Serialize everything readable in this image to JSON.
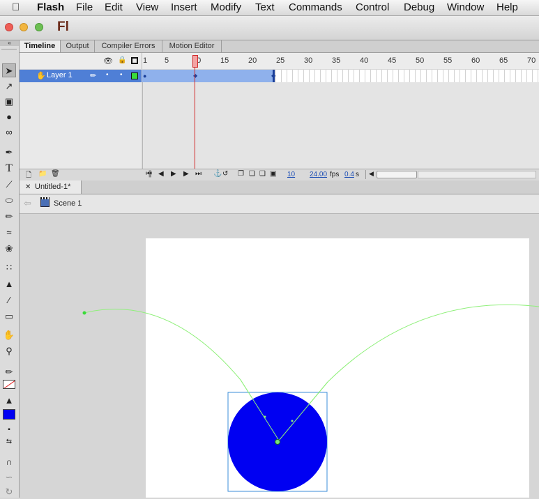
{
  "menubar": {
    "app_name": "Flash",
    "items": [
      "File",
      "Edit",
      "View",
      "Insert",
      "Modify",
      "Text",
      "Commands",
      "Control",
      "Debug",
      "Window",
      "Help"
    ]
  },
  "window": {
    "app_icon_text": "Fl",
    "colors": {
      "close": "#ef5e56",
      "minimize": "#f2b53f",
      "zoom": "#6cbf52"
    }
  },
  "timeline": {
    "tabs": [
      "Timeline",
      "Output",
      "Compiler Errors",
      "Motion Editor"
    ],
    "active_tab": "Timeline",
    "ruler_ticks": [
      "1",
      "5",
      "10",
      "15",
      "20",
      "25",
      "30",
      "35",
      "40",
      "45",
      "50",
      "55",
      "60",
      "65",
      "70"
    ],
    "layer": {
      "name": "Layer 1",
      "color": "#3adb3a"
    },
    "current_frame": "10",
    "frame_rate": "24.00",
    "fps_label": "fps",
    "elapsed": "0.4",
    "elapsed_unit": "s"
  },
  "document": {
    "tab_label": "Untitled-1*",
    "scene_label": "Scene 1"
  },
  "stage": {
    "shape_color": "#0000f2",
    "motion_path_color": "#8ff07a"
  },
  "toolbox": {
    "tools": [
      "selection-tool",
      "subselection-tool",
      "free-transform-tool",
      "3d-rotation-tool",
      "lasso-tool",
      "pen-tool",
      "text-tool",
      "line-tool",
      "oval-tool",
      "pencil-tool",
      "brush-tool",
      "deco-tool",
      "bone-tool",
      "paint-bucket-tool",
      "eyedropper-tool",
      "eraser-tool",
      "hand-tool",
      "zoom-tool"
    ],
    "fill_color": "#0000f2"
  }
}
